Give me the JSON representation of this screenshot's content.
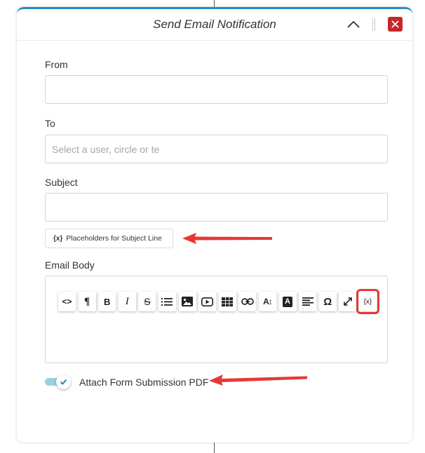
{
  "dialog": {
    "title": "Send Email Notification"
  },
  "form": {
    "from": {
      "label": "From",
      "value": "",
      "placeholder": ""
    },
    "to": {
      "label": "To",
      "value": "",
      "placeholder": "Select a user, circle or te"
    },
    "subject": {
      "label": "Subject",
      "value": "",
      "placeholder": ""
    },
    "placeholders_button": {
      "icon": "{x}",
      "label": "Placeholders for Subject Line"
    },
    "email_body": {
      "label": "Email Body",
      "toolbar": [
        {
          "name": "source-code",
          "glyph": "<>"
        },
        {
          "name": "paragraph",
          "glyph": "¶"
        },
        {
          "name": "bold",
          "glyph": "B"
        },
        {
          "name": "italic",
          "glyph": "I"
        },
        {
          "name": "strikethrough",
          "glyph": "S"
        },
        {
          "name": "list",
          "glyph": ""
        },
        {
          "name": "image",
          "glyph": ""
        },
        {
          "name": "video",
          "glyph": ""
        },
        {
          "name": "table",
          "glyph": ""
        },
        {
          "name": "link",
          "glyph": ""
        },
        {
          "name": "font-size",
          "glyph": "A↕"
        },
        {
          "name": "font-color",
          "glyph": "A"
        },
        {
          "name": "align",
          "glyph": ""
        },
        {
          "name": "special-characters",
          "glyph": "Ω"
        },
        {
          "name": "fullscreen",
          "glyph": ""
        },
        {
          "name": "placeholders",
          "glyph": "{x}"
        }
      ]
    },
    "attach_pdf": {
      "label": "Attach Form Submission PDF",
      "checked": true
    }
  },
  "colors": {
    "accent": "#1f8fc4",
    "close": "#c62828",
    "annotation": "#e53935",
    "toggle_track": "#9ccfe3"
  }
}
